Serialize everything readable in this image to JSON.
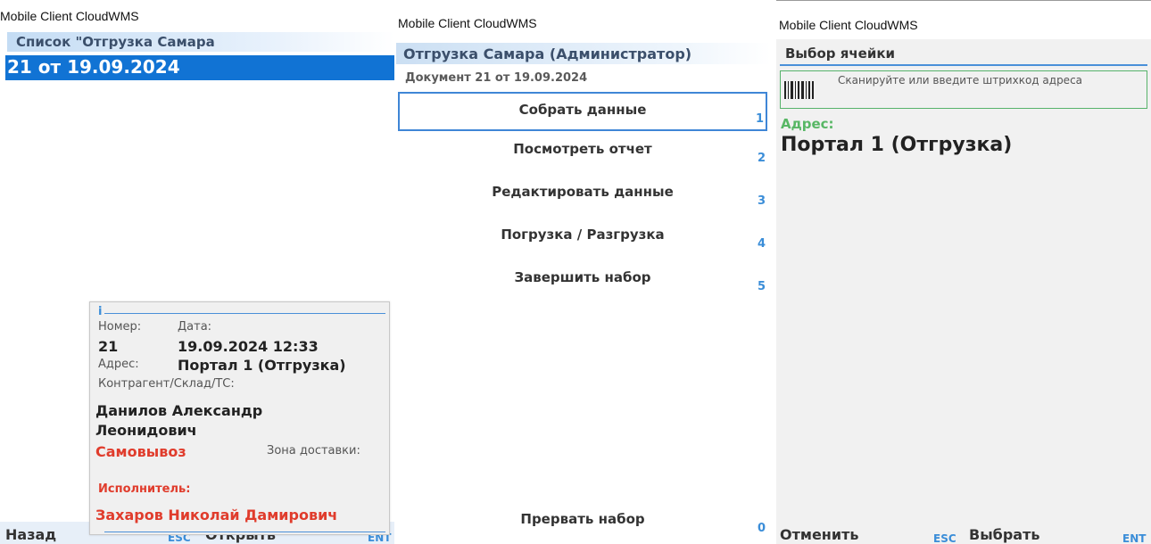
{
  "panel1": {
    "window_title": "Mobile Client CloudWMS",
    "list_header": "Список \"Отгрузка Самара",
    "selected_row": "21 от 19.09.2024",
    "info": {
      "icon": "i",
      "number_label": "Номер:",
      "date_label": "Дата:",
      "number": "21",
      "date": "19.09.2024 12:33",
      "address_label": "Адрес:",
      "address": "Портал 1 (Отгрузка)",
      "contractor_label": "Контрагент/Склад/ТС:",
      "contractor_line1": "Данилов Александр",
      "contractor_line2": "Леонидович",
      "delivery": "Самовывоз",
      "zone_label": "Зона доставки:",
      "executor_label": "Исполнитель:",
      "executor": "Захаров Николай Дамирович"
    },
    "bottom": {
      "back": "Назад",
      "esc": "ESC",
      "open": "Открыть",
      "ent": "ENT"
    }
  },
  "panel2": {
    "window_title": "Mobile Client CloudWMS",
    "header": "Отгрузка Самара (Администратор)",
    "subheader": "Документ 21 от 19.09.2024",
    "menu": [
      {
        "label": "Собрать данные",
        "num": "1"
      },
      {
        "label": "Посмотреть отчет",
        "num": "2"
      },
      {
        "label": "Редактировать данные",
        "num": "3"
      },
      {
        "label": "Погрузка / Разгрузка",
        "num": "4"
      },
      {
        "label": "Завершить набор",
        "num": "5"
      }
    ],
    "abort": {
      "label": "Прервать набор",
      "num": "0"
    }
  },
  "panel3": {
    "window_title": "Mobile Client CloudWMS",
    "header": "Выбор ячейки",
    "scan_placeholder": "Сканируйте или введите штрихкод адреса",
    "address_label": "Адрес:",
    "address": "Портал 1 (Отгрузка)",
    "bottom": {
      "cancel": "Отменить",
      "esc": "ESC",
      "choose": "Выбрать",
      "ent": "ENT"
    }
  },
  "colors": {
    "accent": "#1173d4",
    "key_blue": "#3a8dd8",
    "red": "#e03c2c",
    "green": "#58b765"
  }
}
